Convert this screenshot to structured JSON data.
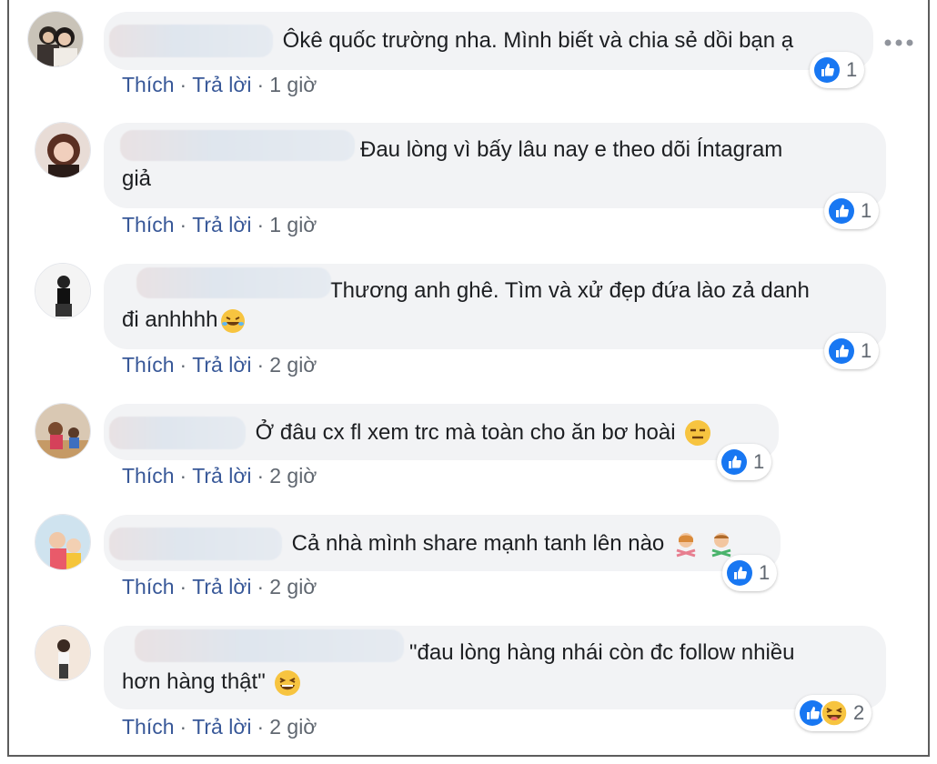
{
  "actions": {
    "like": "Thích",
    "reply": "Trả lời",
    "separator": "·"
  },
  "comments": [
    {
      "text": "Ôkê quốc trường nha. Mình biết và chia sẻ dồi bạn ạ",
      "time": "1 giờ",
      "reaction_count": "1"
    },
    {
      "text_line1": "Đau lòng vì bấy lâu nay e theo dõi Íntagram",
      "text_line2": "giả",
      "time": "1 giờ",
      "reaction_count": "1"
    },
    {
      "text_line1": "Thương anh ghê. Tìm và xử đẹp đứa lào zả danh",
      "text_line2": "đi anhhhh",
      "time": "2 giờ",
      "reaction_count": "1"
    },
    {
      "text": "Ở đâu cx fl xem trc mà toàn cho ăn bơ hoài",
      "time": "2 giờ",
      "reaction_count": "1"
    },
    {
      "text": "Cả nhà mình share mạnh tanh lên nào",
      "time": "2 giờ",
      "reaction_count": "1"
    },
    {
      "text_line1": "\"đau lòng hàng nhái còn đc follow nhiều",
      "text_line2": "hơn hàng thật\"",
      "time": "2 giờ",
      "reaction_count": "2"
    }
  ],
  "colors": {
    "link": "#385898",
    "bubble": "#f2f3f5",
    "like": "#1877f2"
  }
}
